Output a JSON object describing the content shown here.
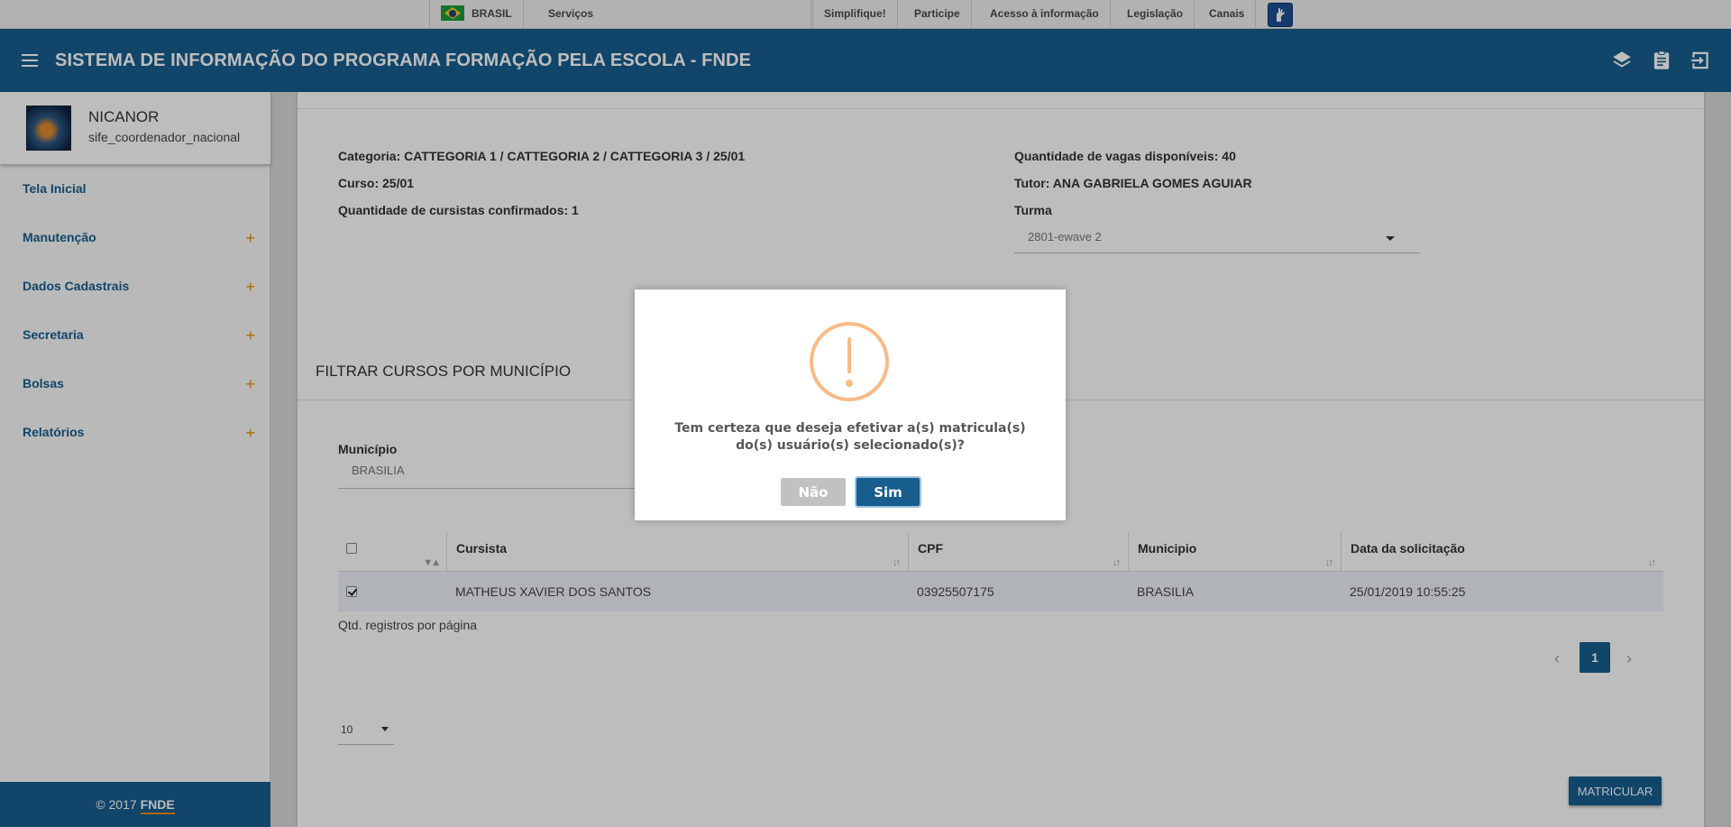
{
  "govbar": {
    "country": "BRASIL",
    "services": "Serviços",
    "links": [
      "Simplifique!",
      "Participe",
      "Acesso à informação",
      "Legislação",
      "Canais"
    ]
  },
  "header": {
    "title": "SISTEMA DE INFORMAÇÃO DO PROGRAMA FORMAÇÃO PELA ESCOLA - FNDE"
  },
  "user": {
    "name": "NICANOR",
    "role": "sife_coordenador_nacional"
  },
  "sidebar": {
    "items": [
      {
        "label": "Tela Inicial",
        "expand": ""
      },
      {
        "label": "Manutenção",
        "expand": "+"
      },
      {
        "label": "Dados Cadastrais",
        "expand": "+"
      },
      {
        "label": "Secretaria",
        "expand": "+"
      },
      {
        "label": "Bolsas",
        "expand": "+"
      },
      {
        "label": "Relatórios",
        "expand": "+"
      }
    ],
    "footer_copy": "© 2017",
    "footer_brand": "FNDE"
  },
  "course": {
    "categoria": "Categoria: CATTEGORIA 1 / CATTEGORIA 2 / CATTEGORIA 3 / 25/01",
    "curso": "Curso: 25/01",
    "confirmados": "Quantidade de cursistas confirmados: 1",
    "vagas": "Quantidade de vagas disponíveis: 40",
    "tutor": "Tutor: ANA GABRIELA GOMES AGUIAR",
    "turma_label": "Turma",
    "turma_value": "2801-ewave 2"
  },
  "filter": {
    "title": "FILTRAR CURSOS POR MUNICÍPIO",
    "municipio_label": "Município",
    "municipio_value": "BRASILIA"
  },
  "table": {
    "columns": [
      "Cursista",
      "CPF",
      "Municipio",
      "Data da solicitação"
    ],
    "rows": [
      {
        "cursista": "MATHEUS XAVIER DOS SANTOS",
        "cpf": "03925507175",
        "municipio": "BRASILIA",
        "data": "25/01/2019 10:55:25",
        "checked": true
      }
    ],
    "per_page_label": "Qtd. registros por página",
    "page": "1",
    "page_size": "10",
    "prev": "‹",
    "next": "›"
  },
  "actions": {
    "matricular": "MATRICULAR"
  },
  "modal": {
    "message": "Tem certeza que deseja efetivar a(s) matricula(s) do(s) usuário(s) selecionado(s)?",
    "no": "Não",
    "yes": "Sim"
  },
  "colors": {
    "primary": "#175d8e",
    "accent": "#f08c00",
    "warning": "#f8bb86"
  }
}
